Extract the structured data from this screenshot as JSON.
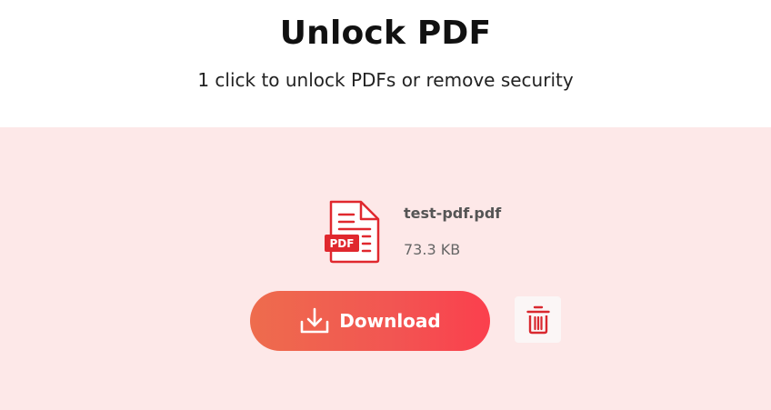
{
  "header": {
    "title": "Unlock PDF",
    "subtitle": "1 click to unlock PDFs or remove security"
  },
  "file": {
    "name": "test-pdf.pdf",
    "size": "73.3 KB",
    "badge": "PDF",
    "icon": "pdf-file-icon"
  },
  "actions": {
    "download_label": "Download",
    "download_icon": "download-icon",
    "delete_icon": "trash-icon"
  },
  "colors": {
    "panel_bg": "#fde8e8",
    "accent_start": "#ee6c4d",
    "accent_end": "#fb3f4d",
    "pdf_red": "#e0282e",
    "trash_red": "#d9282f"
  }
}
